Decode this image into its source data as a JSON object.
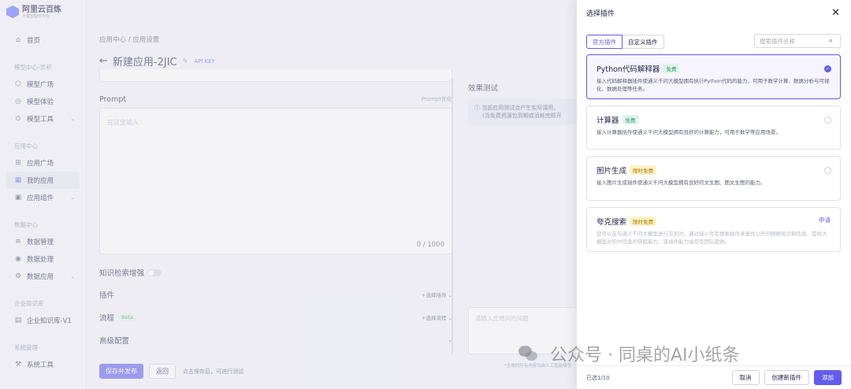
{
  "sidebar": {
    "logo_title": "阿里云百炼",
    "logo_subtitle": "大模型服务平台",
    "home": "首页",
    "groups": [
      {
        "label": "模型中心-灵积",
        "items": [
          "模型广场",
          "模型体验",
          "模型工具"
        ]
      },
      {
        "label": "应用中心",
        "items": [
          "应用广场",
          "我的应用",
          "应用组件"
        ]
      },
      {
        "label": "数据中心",
        "items": [
          "数据管理",
          "数据处理",
          "数据应用"
        ]
      },
      {
        "label": "企业知识库",
        "items": [
          "企业知识库-V1"
        ]
      },
      {
        "label": "系统管理",
        "items": [
          "系统工具"
        ]
      }
    ]
  },
  "main": {
    "breadcrumb": "应用中心 / 应用设置",
    "title": "新建应用-2JIC",
    "apikey": "API KEY",
    "prompt_label": "Prompt",
    "prompt_right": "Prompt优化",
    "prompt_placeholder": "在这里输入",
    "prompt_count": "0 / 1000",
    "kb_label": "知识检索增强",
    "plugin_label": "插件",
    "plugin_action": "+选择插件",
    "flow_label": "流程",
    "flow_badge": "Beta",
    "flow_action": "+选择流程",
    "advanced_label": "高级配置",
    "save_publish": "保存并发布",
    "back": "返回",
    "save_tip": "点击保存后，可进行测试",
    "test_title": "效果测试",
    "notice_line1": "当前应用测试会产生实际调用，",
    "notice_line2": "(当免费资源包到期或消耗完即开",
    "ask_placeholder": "请输入您想问的问题",
    "ask_tip": "*生成的所有内容均由人工智能模型"
  },
  "drawer": {
    "title": "选择插件",
    "tabs": [
      "官方插件",
      "自定义插件"
    ],
    "search_placeholder": "搜索插件名称",
    "cards": [
      {
        "name": "Python代码解释器",
        "badge": "免费",
        "badge_type": "free",
        "desc": "接入代码解释器插件使通义千问大模型拥有执行Python代码的能力，可用于数学计算、数据分析与可视化、数据处理等任务。",
        "checked": true
      },
      {
        "name": "计算器",
        "badge": "免费",
        "badge_type": "free",
        "desc": "接入计算器插件使通义千问大模型拥有良好的计算能力，可用于数学等应用场景。",
        "checked": false
      },
      {
        "name": "图片生成",
        "badge": "限时免费",
        "badge_type": "limited",
        "desc": "接入图片生成插件使通义千问大模型拥有良好的文生图、图文生图的能力。",
        "checked": false
      },
      {
        "name": "夸克搜索",
        "badge": "限时免费",
        "badge_type": "limited",
        "desc": "您可以在与通义千问大模型进行交互时，通过接入夸克搜索插件来查找公开的网络知识和信息，提供大模型对实时信息的获取能力。该插件能力由夸克团队提供。",
        "apply": "申请"
      }
    ],
    "selected_count": "已选1/10",
    "cancel": "取消",
    "create": "创建新插件",
    "add": "添加"
  },
  "watermark": "公众号 · 同桌的AI小纸条"
}
